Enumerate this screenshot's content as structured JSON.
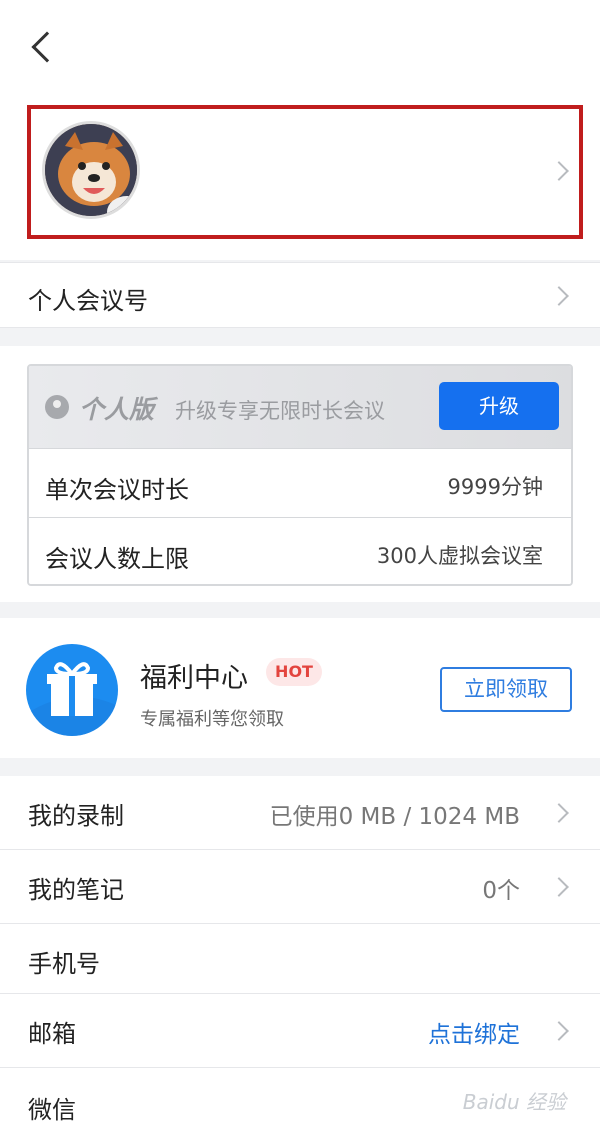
{
  "profile": {},
  "meeting_id": {
    "label": "个人会议号"
  },
  "plan": {
    "name": "个人版",
    "promo": "升级专享无限时长会议",
    "upgrade_label": "升级",
    "rows": [
      {
        "label": "单次会议时长",
        "value": "9999分钟"
      },
      {
        "label": "会议人数上限",
        "value": "300人虚拟会议室"
      }
    ]
  },
  "welfare": {
    "title": "福利中心",
    "badge": "HOT",
    "subtitle": "专属福利等您领取",
    "claim_label": "立即领取"
  },
  "settings": [
    {
      "label": "我的录制",
      "value": "已使用0 MB / 1024 MB"
    },
    {
      "label": "我的笔记",
      "value": "0个"
    },
    {
      "label": "手机号",
      "value": ""
    },
    {
      "label": "邮箱",
      "value": "点击绑定"
    },
    {
      "label": "微信",
      "value": ""
    }
  ],
  "watermark": "Baidu 经验",
  "colors": {
    "accent": "#1570ef",
    "highlight": "#c01d1d",
    "hot": "#e3443e"
  }
}
